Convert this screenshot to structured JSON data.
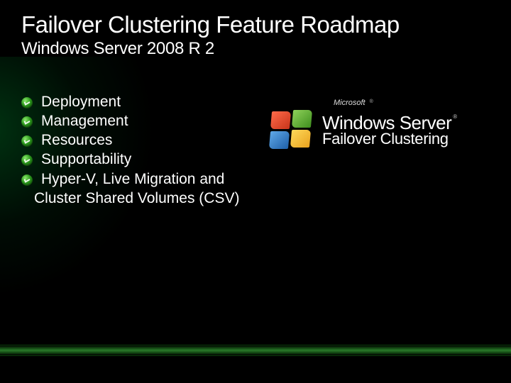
{
  "title": "Failover Clustering Feature Roadmap",
  "subtitle": "Windows Server 2008 R 2",
  "bullets": [
    "Deployment",
    "Management",
    "Resources",
    "Supportability",
    "Hyper-V, Live Migration and"
  ],
  "bullet_continuation": "Cluster Shared Volumes (CSV)",
  "logo": {
    "microsoft": "Microsoft",
    "reg": "®",
    "windows": "Windows",
    "server": "Server",
    "tm": "®",
    "product": "Failover Clustering"
  }
}
